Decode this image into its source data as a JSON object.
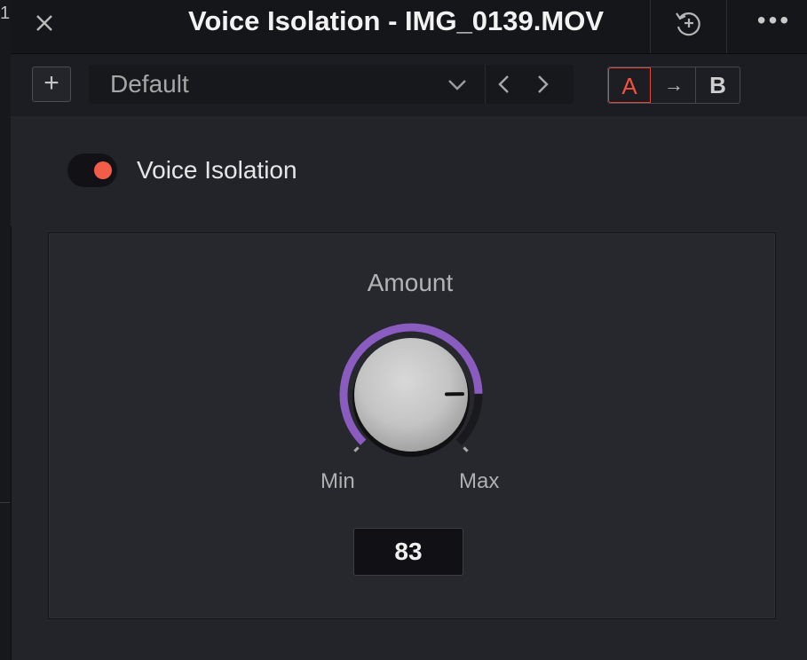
{
  "window": {
    "title": "Voice Isolation - IMG_0139.MOV",
    "left_fragment": "1"
  },
  "titlebar": {
    "close_icon": "close-icon",
    "history_icon": "history-reset-icon",
    "more_label": "•••"
  },
  "toolbar": {
    "add_label": "+",
    "preset_value": "Default",
    "compare": {
      "a_label": "A",
      "arrow_label": "→",
      "b_label": "B"
    },
    "colors": {
      "a_accent": "#f0523e"
    }
  },
  "effect": {
    "name": "Voice Isolation",
    "enabled": true,
    "toggle_color": "#f25d47"
  },
  "control": {
    "label": "Amount",
    "min_label": "Min",
    "max_label": "Max",
    "value": "83",
    "level": 0.83,
    "arc_color": "#8b5cc0"
  }
}
